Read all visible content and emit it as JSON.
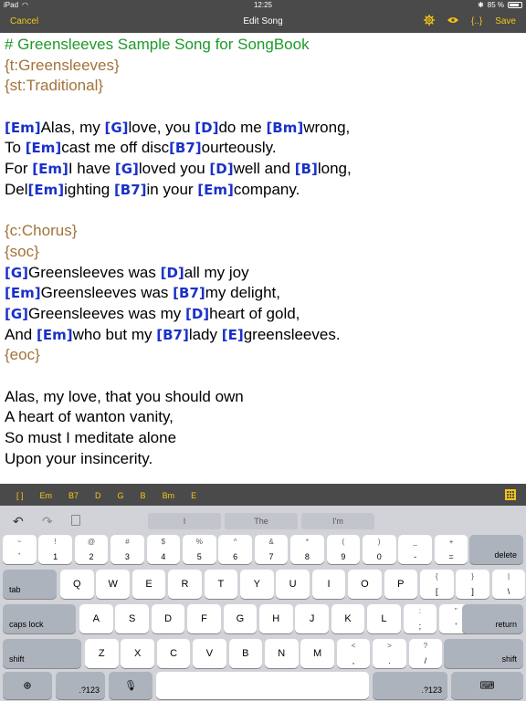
{
  "status": {
    "device": "iPad",
    "time": "12:25",
    "battery": "85 %",
    "battery_level": 0.85
  },
  "nav": {
    "cancel": "Cancel",
    "title": "Edit Song",
    "braces": "{..}",
    "save": "Save"
  },
  "editor_lines": [
    [
      {
        "t": "# Greensleeves Sample Song for SongBook",
        "c": "comment"
      }
    ],
    [
      {
        "t": "{t:Greensleeves}",
        "c": "directive"
      }
    ],
    [
      {
        "t": "{st:Traditional}",
        "c": "directive"
      }
    ],
    [],
    [
      {
        "t": "[Em]",
        "c": "chord"
      },
      {
        "t": "Alas, my "
      },
      {
        "t": "[G]",
        "c": "chord"
      },
      {
        "t": "love, you "
      },
      {
        "t": "[D]",
        "c": "chord"
      },
      {
        "t": "do me "
      },
      {
        "t": "[Bm]",
        "c": "chord"
      },
      {
        "t": "wrong,"
      }
    ],
    [
      {
        "t": "To "
      },
      {
        "t": "[Em]",
        "c": "chord"
      },
      {
        "t": "cast me off disc"
      },
      {
        "t": "[B7]",
        "c": "chord"
      },
      {
        "t": "ourteously."
      }
    ],
    [
      {
        "t": "For "
      },
      {
        "t": "[Em]",
        "c": "chord"
      },
      {
        "t": "I have "
      },
      {
        "t": "[G]",
        "c": "chord"
      },
      {
        "t": "loved you "
      },
      {
        "t": "[D]",
        "c": "chord"
      },
      {
        "t": "well and "
      },
      {
        "t": "[B]",
        "c": "chord"
      },
      {
        "t": "long,"
      }
    ],
    [
      {
        "t": "Del"
      },
      {
        "t": "[Em]",
        "c": "chord"
      },
      {
        "t": "ighting "
      },
      {
        "t": "[B7]",
        "c": "chord"
      },
      {
        "t": "in your "
      },
      {
        "t": "[Em]",
        "c": "chord"
      },
      {
        "t": "company."
      }
    ],
    [],
    [
      {
        "t": "{c:Chorus}",
        "c": "directive"
      }
    ],
    [
      {
        "t": "{soc}",
        "c": "directive"
      }
    ],
    [
      {
        "t": "[G]",
        "c": "chord"
      },
      {
        "t": "Greensleeves was "
      },
      {
        "t": "[D]",
        "c": "chord"
      },
      {
        "t": "all my joy"
      }
    ],
    [
      {
        "t": "[Em]",
        "c": "chord"
      },
      {
        "t": "Greensleeves was "
      },
      {
        "t": "[B7]",
        "c": "chord"
      },
      {
        "t": "my delight,"
      }
    ],
    [
      {
        "t": "[G]",
        "c": "chord"
      },
      {
        "t": "Greensleeves was my "
      },
      {
        "t": "[D]",
        "c": "chord"
      },
      {
        "t": "heart of gold,"
      }
    ],
    [
      {
        "t": "And "
      },
      {
        "t": "[Em]",
        "c": "chord"
      },
      {
        "t": "who but my "
      },
      {
        "t": "[B7]",
        "c": "chord"
      },
      {
        "t": "lady "
      },
      {
        "t": "[E]",
        "c": "chord"
      },
      {
        "t": "greensleeves."
      }
    ],
    [
      {
        "t": "{eoc}",
        "c": "directive"
      }
    ],
    [],
    [
      {
        "t": "Alas, my love, that you should own"
      }
    ],
    [
      {
        "t": "A heart of wanton vanity,"
      }
    ],
    [
      {
        "t": "So must I meditate alone"
      }
    ],
    [
      {
        "t": "Upon your insincerity."
      }
    ]
  ],
  "chord_bar": [
    "[ ]",
    "Em",
    "B7",
    "D",
    "G",
    "B",
    "Bm",
    "E"
  ],
  "suggestions": [
    "I",
    "The",
    "I'm"
  ],
  "keyboard": {
    "row1": [
      [
        "~",
        "`"
      ],
      [
        "!",
        "1"
      ],
      [
        "@",
        "2"
      ],
      [
        "#",
        "3"
      ],
      [
        "$",
        "4"
      ],
      [
        "%",
        "5"
      ],
      [
        "^",
        "6"
      ],
      [
        "&",
        "7"
      ],
      [
        "*",
        "8"
      ],
      [
        "(",
        "9"
      ],
      [
        ")",
        "0"
      ],
      [
        "_",
        "-"
      ],
      [
        "+",
        "="
      ]
    ],
    "delete": "delete",
    "tab": "tab",
    "row2": [
      "Q",
      "W",
      "E",
      "R",
      "T",
      "Y",
      "U",
      "I",
      "O",
      "P"
    ],
    "row2p": [
      [
        "{",
        "["
      ],
      [
        "}",
        "]"
      ],
      [
        "|",
        "\\"
      ]
    ],
    "caps": "caps lock",
    "row3": [
      "A",
      "S",
      "D",
      "F",
      "G",
      "H",
      "J",
      "K",
      "L"
    ],
    "row3p": [
      [
        ":",
        ";"
      ],
      [
        "\"",
        "'"
      ]
    ],
    "return": "return",
    "shift": "shift",
    "row4": [
      "Z",
      "X",
      "C",
      "V",
      "B",
      "N",
      "M"
    ],
    "row4p": [
      [
        "<",
        ","
      ],
      [
        ">",
        "."
      ],
      [
        "?",
        "/"
      ]
    ],
    "num": ".?123"
  },
  "colors": {
    "bar": "#4a4a4a",
    "accent": "#f5c518",
    "chord": "#1a31c9",
    "comment": "#1f9a2a",
    "directive": "#a3733a"
  }
}
